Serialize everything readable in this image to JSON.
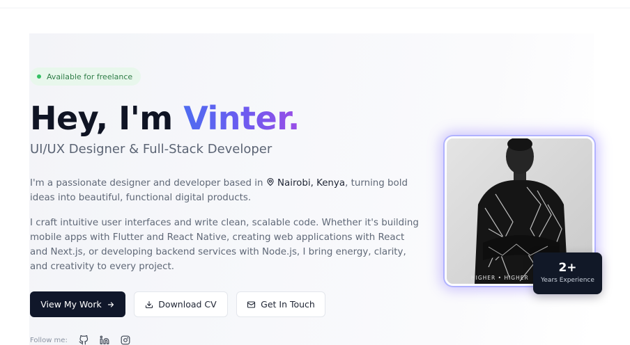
{
  "badge": {
    "label": "Available for freelance"
  },
  "hero": {
    "greeting": "Hey, I'm ",
    "name": "Vinter.",
    "subtitle": "UI/UX Designer & Full-Stack Developer",
    "intro_before": "I'm a passionate designer and developer based in ",
    "location": "Nairobi, Kenya",
    "intro_after": ", turning bold ideas into beautiful, functional digital products.",
    "description": "I craft intuitive user interfaces and write clean, scalable code. Whether it's building mobile apps with Flutter and React Native, creating web applications with React and Next.js, or developing backend services with Node.js, I bring energy, clarity, and creativity to every project."
  },
  "buttons": {
    "view_work": "View My Work",
    "download_cv": "Download CV",
    "get_in_touch": "Get In Touch"
  },
  "social": {
    "label": "Follow me:"
  },
  "photo": {
    "shirt_text": "HIGHER • HIGHER"
  },
  "experience": {
    "value": "2+",
    "label": "Years Experience"
  },
  "colors": {
    "accent_gradient_start": "#4f6cf0",
    "accent_gradient_end": "#9a4de6",
    "primary_button": "#10172a",
    "badge_bg": "#e8f7ec",
    "badge_dot": "#34c063"
  },
  "icons": {
    "arrow": "arrow-right-icon",
    "download": "download-icon",
    "mail": "mail-icon",
    "location": "map-pin-icon",
    "github": "github-icon",
    "linkedin": "linkedin-icon",
    "instagram": "instagram-icon"
  }
}
